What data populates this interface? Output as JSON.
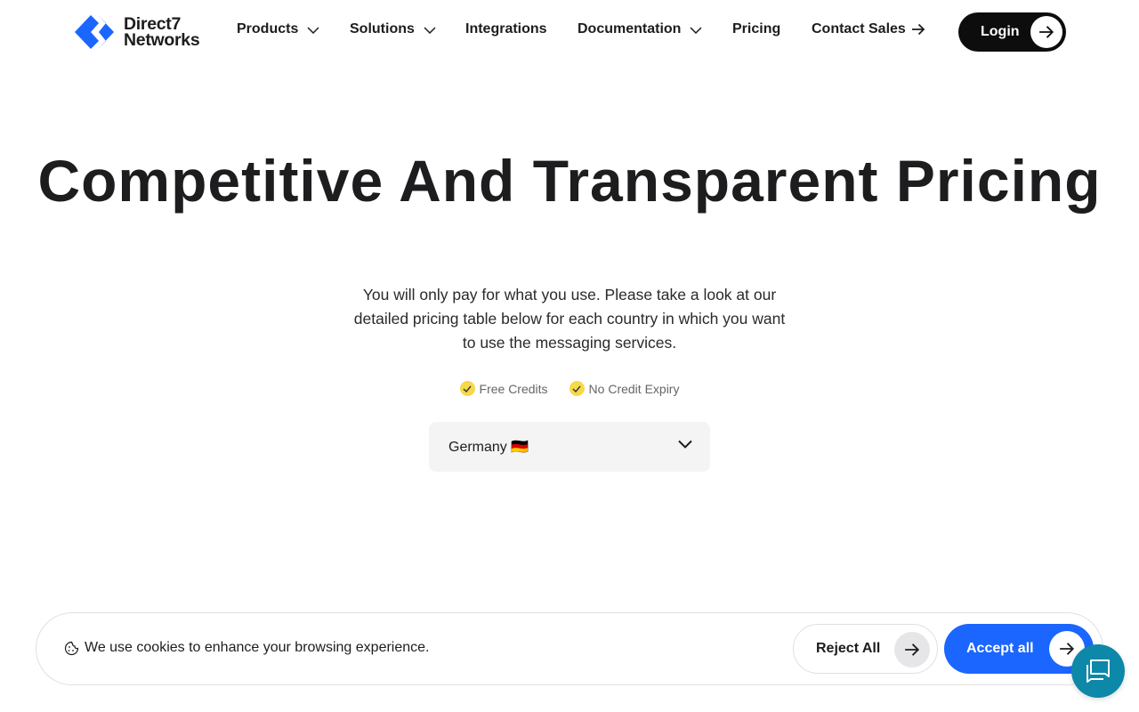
{
  "header": {
    "logo_line1": "Direct7",
    "logo_line2": "Networks",
    "nav": {
      "products": "Products",
      "solutions": "Solutions",
      "integrations": "Integrations",
      "documentation": "Documentation",
      "pricing": "Pricing",
      "contact_sales": "Contact Sales"
    },
    "login_label": "Login"
  },
  "hero": {
    "title": "Competitive And Transparent Pricing",
    "subtitle": "You will only pay for what you use. Please take a look at our detailed pricing table below for each country in which you want to use the messaging services.",
    "badges": [
      "Free Credits",
      "No Credit Expiry"
    ]
  },
  "country_select": {
    "selected": "Germany 🇩🇪"
  },
  "cookie_banner": {
    "text": "We use cookies to enhance your browsing experience.",
    "reject_label": "Reject All",
    "accept_label": "Accept all"
  },
  "colors": {
    "brand_blue": "#1a66ff",
    "login_bg": "#0d0d0d",
    "chat_bg": "#0d88a8",
    "check_yellow": "#f5d94a",
    "select_bg": "#f4f4f5"
  },
  "icons": [
    "direct7-logo-icon",
    "chevron-down-icon",
    "arrow-right-icon",
    "check-icon",
    "cookie-icon",
    "chat-icon"
  ]
}
